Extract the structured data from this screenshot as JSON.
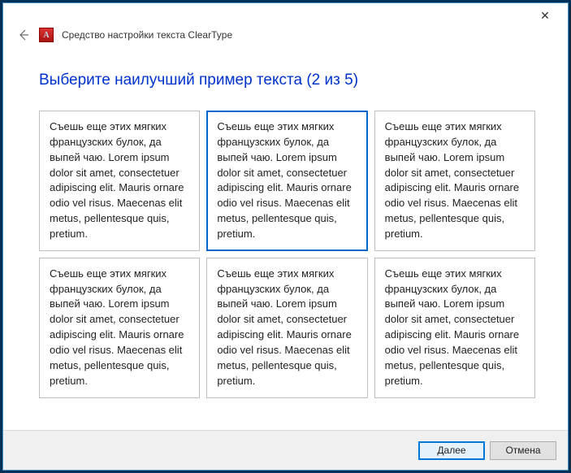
{
  "window": {
    "close_glyph": "✕"
  },
  "header": {
    "back_glyph": "←",
    "icon_letter": "A",
    "title": "Средство настройки текста ClearType"
  },
  "instruction": "Выберите наилучший пример текста (2 из 5)",
  "sample_text": "Съешь еще этих мягких французских булок, да выпей чаю. Lorem ipsum dolor sit amet, consectetuer adipiscing elit. Mauris ornare odio vel risus. Maecenas elit metus, pellentesque quis, pretium.",
  "samples": {
    "0": {
      "selected": false
    },
    "1": {
      "selected": true
    },
    "2": {
      "selected": false
    },
    "3": {
      "selected": false
    },
    "4": {
      "selected": false
    },
    "5": {
      "selected": false
    }
  },
  "footer": {
    "next_label": "Далее",
    "cancel_label": "Отмена"
  }
}
